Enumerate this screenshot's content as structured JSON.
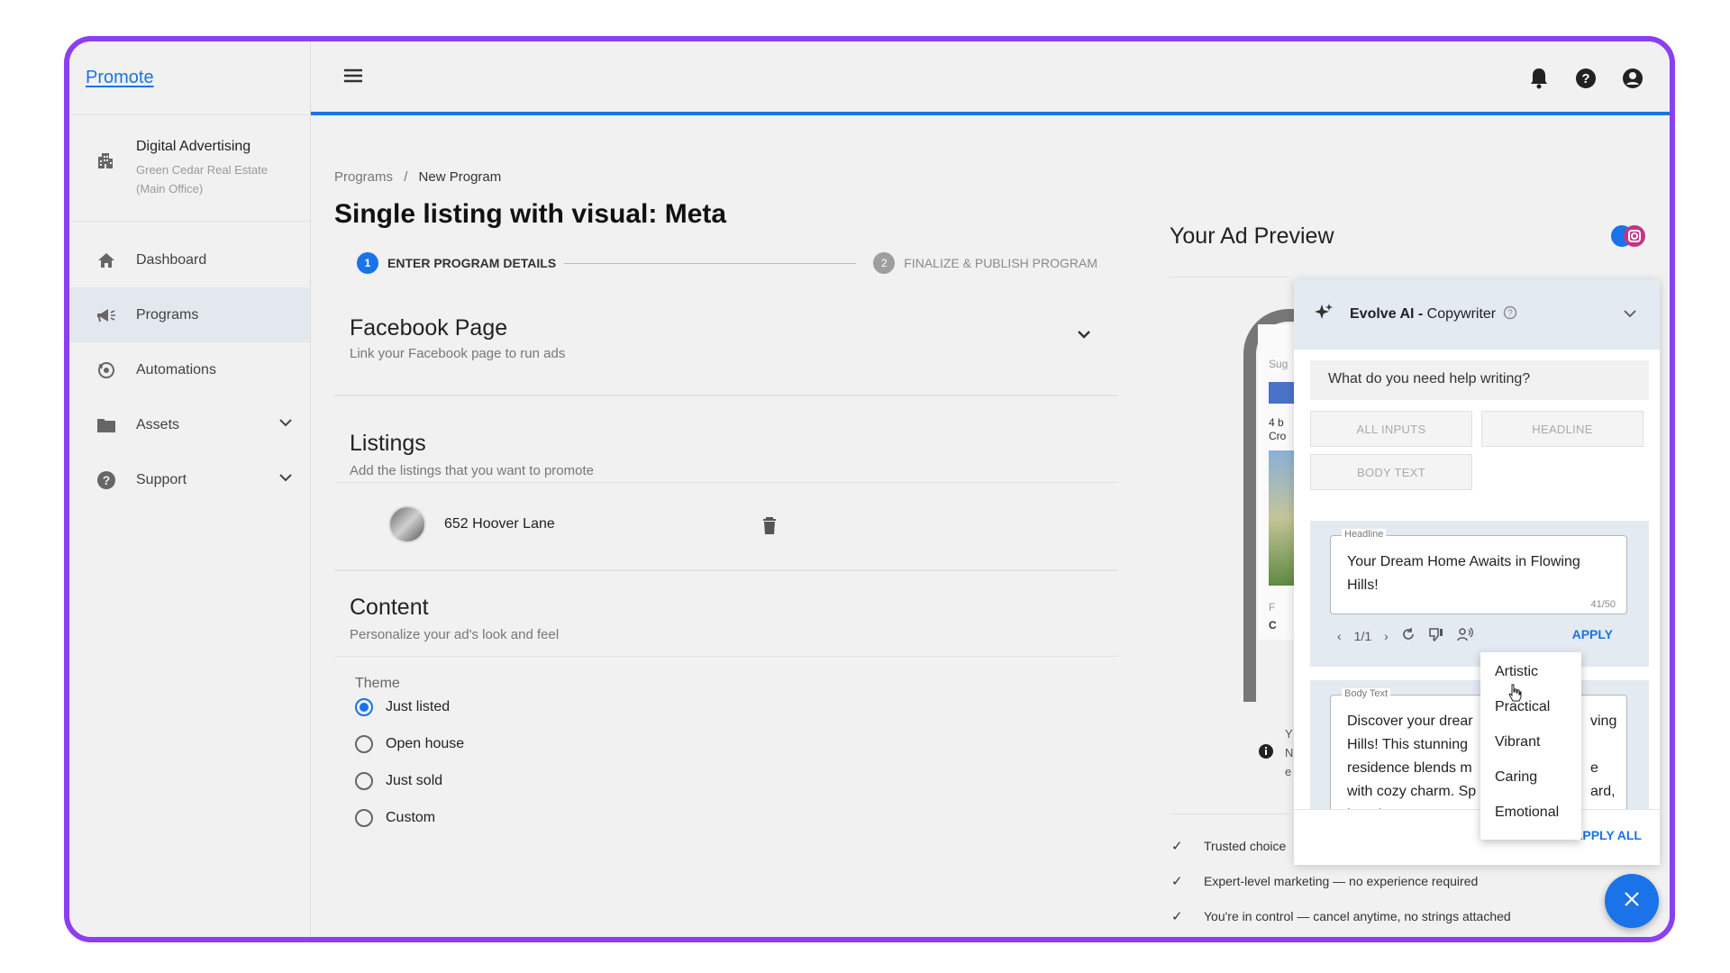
{
  "app": {
    "brand": "Promote"
  },
  "sidebar": {
    "org_title": "Digital Advertising",
    "org_sub": "Green Cedar Real Estate (Main Office)",
    "items": [
      {
        "label": "Dashboard",
        "icon": "home-icon"
      },
      {
        "label": "Programs",
        "icon": "megaphone-icon",
        "active": true
      },
      {
        "label": "Automations",
        "icon": "automation-icon"
      },
      {
        "label": "Assets",
        "icon": "folder-icon",
        "expandable": true
      },
      {
        "label": "Support",
        "icon": "help-icon",
        "expandable": true
      }
    ]
  },
  "topbar": {
    "icons": [
      "menu-icon",
      "bell-icon",
      "help-icon",
      "account-icon"
    ]
  },
  "breadcrumb": {
    "root": "Programs",
    "separator": "/",
    "current": "New Program"
  },
  "page_title": "Single listing with visual: Meta",
  "stepper": {
    "step1": {
      "num": "1",
      "label": "ENTER PROGRAM DETAILS"
    },
    "step2": {
      "num": "2",
      "label": "FINALIZE & PUBLISH PROGRAM"
    }
  },
  "facebook": {
    "title": "Facebook Page",
    "sub": "Link your Facebook page to run ads"
  },
  "listings": {
    "title": "Listings",
    "sub": "Add the listings that you want to promote",
    "items": [
      "652 Hoover Lane"
    ]
  },
  "content": {
    "title": "Content",
    "sub": "Personalize your ad's look and feel",
    "theme_label": "Theme",
    "themes": [
      "Just listed",
      "Open house",
      "Just sold",
      "Custom"
    ],
    "selected_theme": "Just listed"
  },
  "preview": {
    "title": "Your Ad Preview",
    "phone_sug": "Sug",
    "phone_line1": "4 b",
    "phone_line2": "Cro",
    "phone_f": "F",
    "phone_c": "C",
    "info_frag1": "Y",
    "info_frag2": "N",
    "info_frag3": "e",
    "features": [
      "Trusted choice",
      "Expert-level marketing — no experience required",
      "You're in control — cancel anytime, no strings attached"
    ]
  },
  "ai": {
    "title_bold": "Evolve AI -",
    "title_rest": " Copywriter",
    "prompt": "What do you need help writing?",
    "tabs": [
      "ALL INPUTS",
      "HEADLINE",
      "BODY TEXT"
    ],
    "headline_label": "Headline",
    "headline_text": "Your Dream Home Awaits in Flowing Hills!",
    "headline_count": "41/50",
    "pager": "1/1",
    "apply": "APPLY",
    "body_label": "Body Text",
    "body_line1": "Discover your drear",
    "body_line1_end": "ving",
    "body_line2": "Hills! This stunning",
    "body_line3": "residence blends m",
    "body_line3_end": "e",
    "body_line4": "with cozy charm. Sp",
    "body_line4_end": "ard,",
    "body_line5": "luxurious master su",
    "apply_all": "APPLY ALL",
    "tone_options": [
      "Artistic",
      "Practical",
      "Vibrant",
      "Caring",
      "Emotional"
    ]
  },
  "colors": {
    "accent": "#1a73e8",
    "frame": "#8b3ff0"
  }
}
